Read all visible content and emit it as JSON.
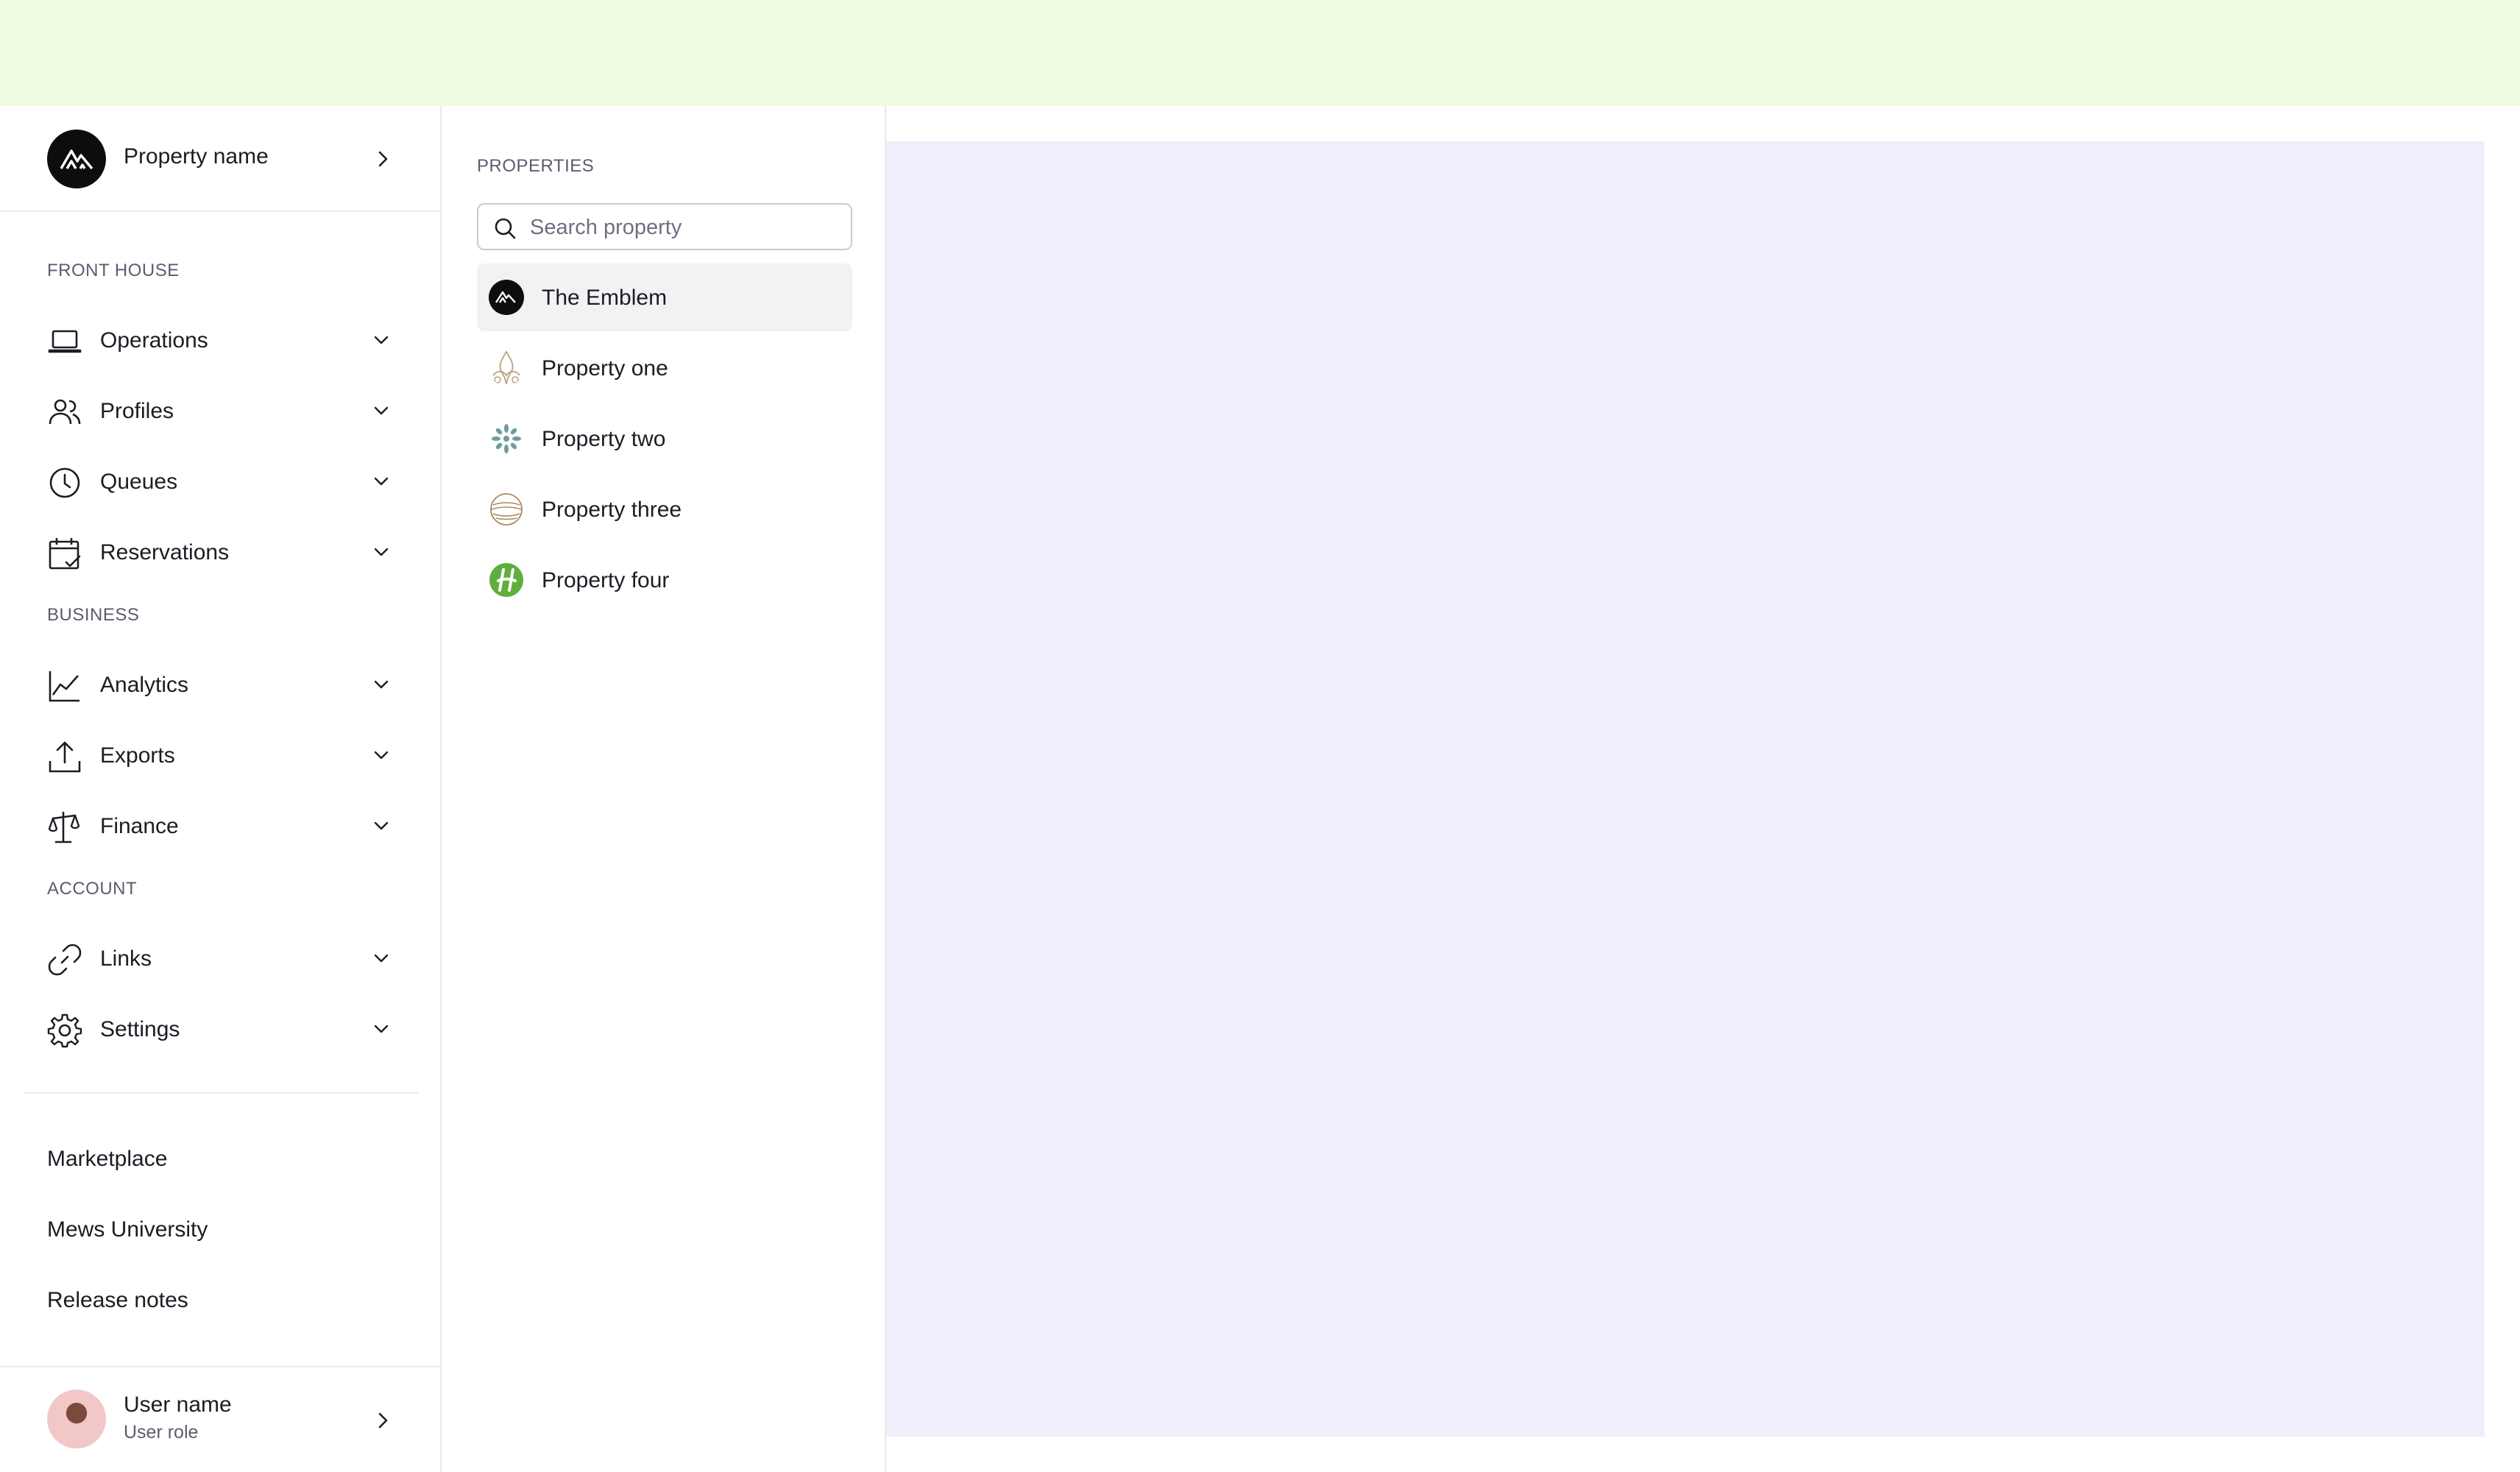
{
  "colors": {
    "topbar": "#eefbe0",
    "content_placeholder": "#efeffb",
    "selected_row": "#f2f2f5",
    "text_primary": "#1c1d24",
    "text_secondary": "#5b5d6e"
  },
  "property_header": {
    "name": "Property name",
    "logo_icon": "mountain-logo-icon",
    "chevron_icon": "chevron-right-icon"
  },
  "sidebar": {
    "sections": [
      {
        "label": "FRONT HOUSE",
        "items": [
          {
            "label": "Operations",
            "icon": "laptop-icon"
          },
          {
            "label": "Profiles",
            "icon": "users-icon"
          },
          {
            "label": "Queues",
            "icon": "clock-icon"
          },
          {
            "label": "Reservations",
            "icon": "calendar-check-icon"
          }
        ]
      },
      {
        "label": "BUSINESS",
        "items": [
          {
            "label": "Analytics",
            "icon": "line-chart-icon"
          },
          {
            "label": "Exports",
            "icon": "upload-icon"
          },
          {
            "label": "Finance",
            "icon": "scale-icon"
          }
        ]
      },
      {
        "label": "ACCOUNT",
        "items": [
          {
            "label": "Links",
            "icon": "link-icon"
          },
          {
            "label": "Settings",
            "icon": "gear-icon"
          }
        ]
      }
    ],
    "footer_links": [
      "Marketplace",
      "Mews University",
      "Release notes"
    ]
  },
  "user": {
    "name": "User name",
    "role": "User role"
  },
  "properties_panel": {
    "title": "PROPERTIES",
    "search": {
      "placeholder": "Search property",
      "value": ""
    },
    "items": [
      {
        "label": "The Emblem",
        "logo": "emblem-logo-icon",
        "selected": true
      },
      {
        "label": "Property one",
        "logo": "ornament-logo-icon",
        "selected": false
      },
      {
        "label": "Property two",
        "logo": "star-burst-logo-icon",
        "selected": false
      },
      {
        "label": "Property three",
        "logo": "globe-lines-logo-icon",
        "selected": false
      },
      {
        "label": "Property four",
        "logo": "green-h-logo-icon",
        "selected": false
      }
    ]
  }
}
